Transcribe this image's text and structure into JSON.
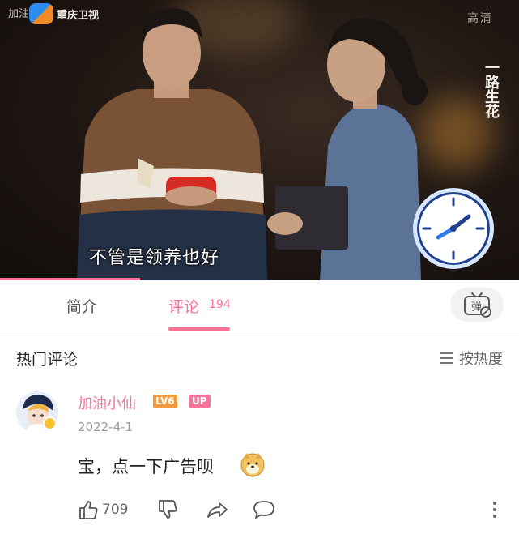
{
  "video": {
    "watermark_left": "加油小仙",
    "channel": "重庆卫视",
    "quality_mark": "高清",
    "show_name": "一路生花",
    "subtitle": "不管是领养也好",
    "clock_overlay": "clock-icon",
    "progress": 0.27
  },
  "tabs": {
    "intro": "简介",
    "comments": "评论",
    "comments_count": "194",
    "danmaku_icon": "danmaku-tv-icon"
  },
  "comments": {
    "section_title": "热门评论",
    "sort_label": "按热度",
    "sort_icon": "sort-lines-icon",
    "items": [
      {
        "username": "加油小仙",
        "level": "LV6",
        "badge": "UP",
        "date": "2022-4-1",
        "text": "宝，点一下广告呗",
        "emoji": "doge-emoji",
        "likes": "709",
        "actions": [
          "thumbs-up-icon",
          "thumbs-down-icon",
          "share-icon",
          "reply-icon",
          "more-icon"
        ]
      }
    ]
  },
  "colors": {
    "accent": "#fb7299",
    "level_badge": "#f49a3c",
    "muted_text": "#999999"
  }
}
